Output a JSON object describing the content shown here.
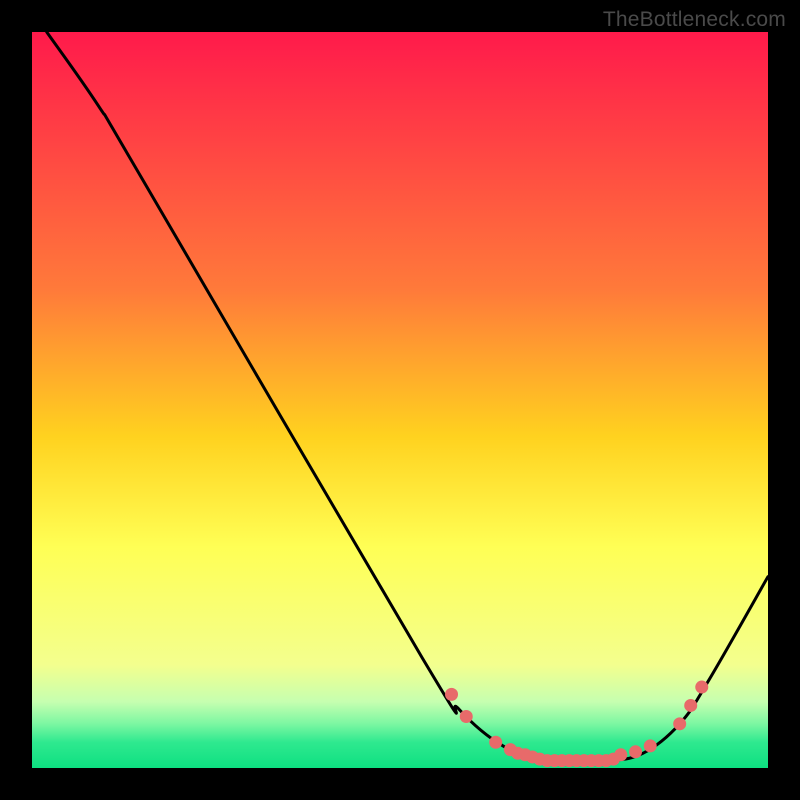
{
  "watermark": "TheBottleneck.com",
  "chart_data": {
    "type": "line",
    "title": "",
    "xlabel": "",
    "ylabel": "",
    "xlim": [
      0,
      100
    ],
    "ylim": [
      0,
      100
    ],
    "grid": false,
    "series": [
      {
        "name": "curve",
        "points": [
          {
            "x": 2,
            "y": 100
          },
          {
            "x": 9,
            "y": 90
          },
          {
            "x": 15,
            "y": 80
          },
          {
            "x": 53,
            "y": 15
          },
          {
            "x": 58,
            "y": 8
          },
          {
            "x": 64,
            "y": 3
          },
          {
            "x": 70,
            "y": 1
          },
          {
            "x": 78,
            "y": 1
          },
          {
            "x": 83,
            "y": 2
          },
          {
            "x": 88,
            "y": 6
          },
          {
            "x": 92,
            "y": 12
          },
          {
            "x": 100,
            "y": 26
          }
        ]
      }
    ],
    "markers": [
      {
        "x": 57,
        "y": 10
      },
      {
        "x": 59,
        "y": 7
      },
      {
        "x": 63,
        "y": 3.5
      },
      {
        "x": 65,
        "y": 2.5
      },
      {
        "x": 66,
        "y": 2
      },
      {
        "x": 67,
        "y": 1.8
      },
      {
        "x": 68,
        "y": 1.5
      },
      {
        "x": 69,
        "y": 1.2
      },
      {
        "x": 70,
        "y": 1
      },
      {
        "x": 71,
        "y": 1
      },
      {
        "x": 72,
        "y": 1
      },
      {
        "x": 73,
        "y": 1
      },
      {
        "x": 74,
        "y": 1
      },
      {
        "x": 75,
        "y": 1
      },
      {
        "x": 76,
        "y": 1
      },
      {
        "x": 77,
        "y": 1
      },
      {
        "x": 78,
        "y": 1
      },
      {
        "x": 79,
        "y": 1.2
      },
      {
        "x": 80,
        "y": 1.8
      },
      {
        "x": 82,
        "y": 2.2
      },
      {
        "x": 84,
        "y": 3
      },
      {
        "x": 88,
        "y": 6
      },
      {
        "x": 89.5,
        "y": 8.5
      },
      {
        "x": 91,
        "y": 11
      }
    ],
    "colors": {
      "curve_stroke": "#000000",
      "marker_fill": "#e86a6a",
      "gradient_stops": [
        {
          "offset": 0.0,
          "color": "#ff1a4b"
        },
        {
          "offset": 0.35,
          "color": "#ff7a3a"
        },
        {
          "offset": 0.55,
          "color": "#ffd21f"
        },
        {
          "offset": 0.7,
          "color": "#ffff55"
        },
        {
          "offset": 0.86,
          "color": "#f3ff8e"
        },
        {
          "offset": 0.91,
          "color": "#c6ffb0"
        },
        {
          "offset": 0.94,
          "color": "#7cf7a2"
        },
        {
          "offset": 0.965,
          "color": "#2fe98f"
        },
        {
          "offset": 1.0,
          "color": "#0de081"
        }
      ]
    }
  }
}
